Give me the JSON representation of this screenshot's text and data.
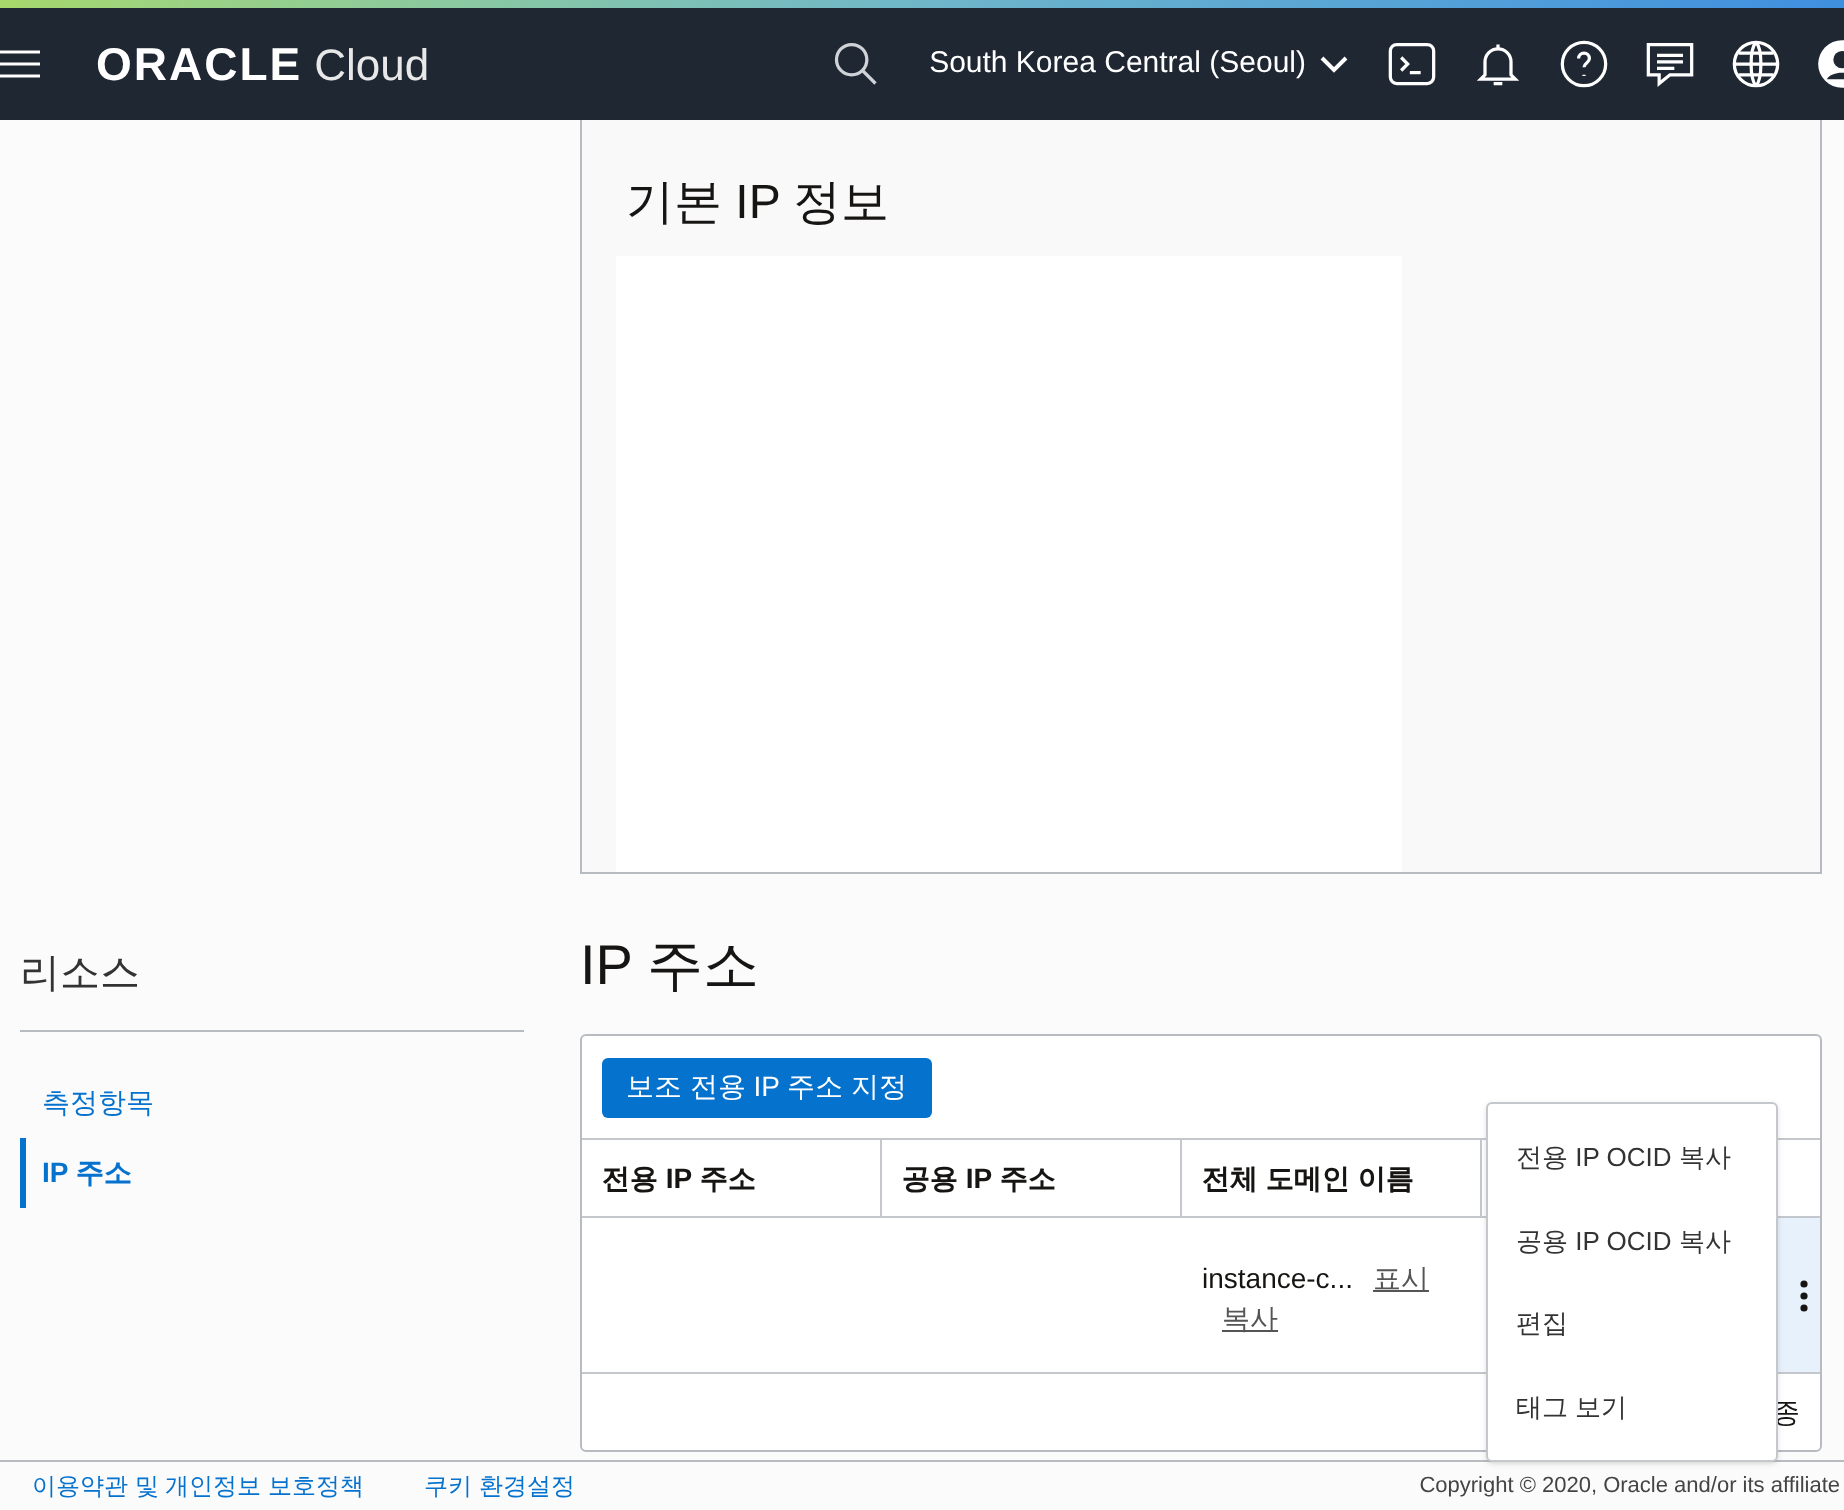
{
  "header": {
    "logo_main": "ORACLE",
    "logo_sub": "Cloud",
    "region": "South Korea Central (Seoul)"
  },
  "basic_panel": {
    "title": "기본 IP 정보"
  },
  "sidebar": {
    "title": "리소스",
    "items": [
      {
        "label": "측정항목",
        "selected": false
      },
      {
        "label": "IP 주소",
        "selected": true
      }
    ]
  },
  "section": {
    "title": "IP 주소",
    "button": "보조 전용 IP 주소 지정"
  },
  "table": {
    "columns": [
      "전용 IP 주소",
      "공용 IP 주소",
      "전체 도메인 이름"
    ],
    "rows": [
      {
        "fqdn": "instance-c...",
        "show": "표시",
        "copy": "복사",
        "highlighted": true
      }
    ],
    "footer_text": "종"
  },
  "menu": {
    "items": [
      "전용 IP OCID 복사",
      "공용 IP OCID 복사",
      "편집",
      "태그 보기"
    ]
  },
  "footer": {
    "links": [
      "이용약관 및 개인정보 보호정책",
      "쿠키 환경설정"
    ],
    "copyright": "Copyright © 2020, Oracle and/or its affiliate"
  }
}
